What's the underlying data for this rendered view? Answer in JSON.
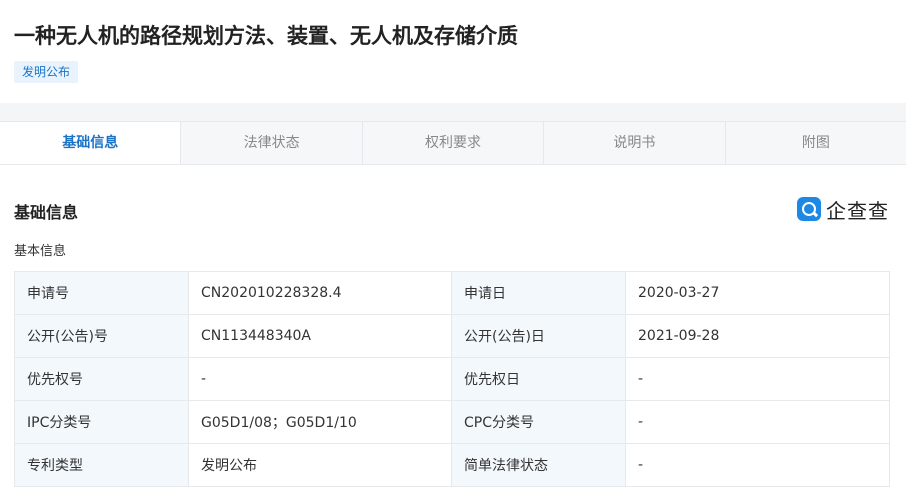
{
  "header": {
    "title": "一种无人机的路径规划方法、装置、无人机及存储介质",
    "badge": "发明公布"
  },
  "tabs": [
    {
      "label": "基础信息",
      "active": true
    },
    {
      "label": "法律状态",
      "active": false
    },
    {
      "label": "权利要求",
      "active": false
    },
    {
      "label": "说明书",
      "active": false
    },
    {
      "label": "附图",
      "active": false
    }
  ],
  "section": {
    "title": "基础信息",
    "logo_text": "企查查",
    "sub_title": "基本信息"
  },
  "info_rows": [
    {
      "k1": "申请号",
      "v1": "CN202010228328.4",
      "k2": "申请日",
      "v2": "2020-03-27"
    },
    {
      "k1": "公开(公告)号",
      "v1": "CN113448340A",
      "k2": "公开(公告)日",
      "v2": "2021-09-28"
    },
    {
      "k1": "优先权号",
      "v1": "-",
      "k2": "优先权日",
      "v2": "-"
    },
    {
      "k1": "IPC分类号",
      "v1": "G05D1/08；G05D1/10",
      "k2": "CPC分类号",
      "v2": "-"
    },
    {
      "k1": "专利类型",
      "v1": "发明公布",
      "k2": "简单法律状态",
      "v2": "-"
    }
  ],
  "colors": {
    "accent": "#1a73c7",
    "badge_bg": "#e8f3fd",
    "key_cell_bg": "#f3f8fd",
    "logo_blue": "#1e88e5"
  }
}
